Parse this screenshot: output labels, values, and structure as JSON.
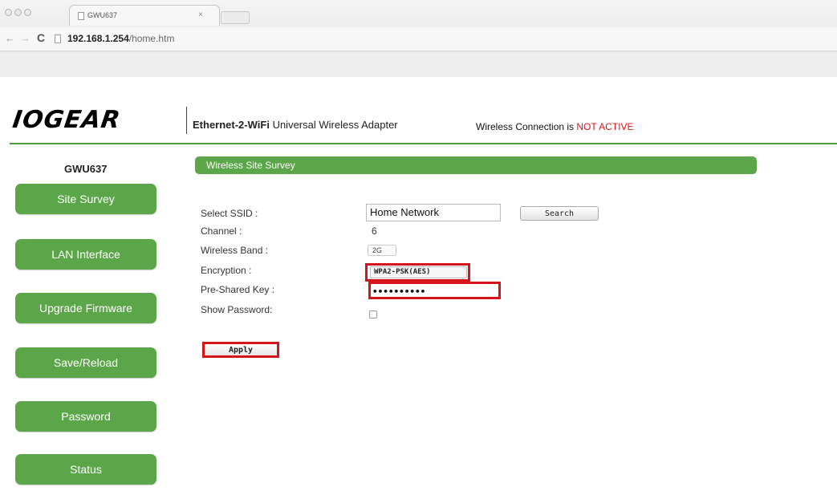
{
  "browser": {
    "tab_title": "GWU637",
    "tab_close": "×",
    "url_host": "192.168.1.254",
    "url_path": "/home.htm",
    "back_glyph": "←",
    "forward_glyph": "→",
    "reload_glyph": "C"
  },
  "header": {
    "logo": "IOGEAR",
    "tagline_bold": "Ethernet-2-WiFi",
    "tagline_rest": " Universal Wireless Adapter",
    "status_prefix": "Wireless Connection is ",
    "status_value": "NOT ACTIVE",
    "status_color": "#e0141a",
    "accent_color": "#5ba648"
  },
  "sidebar": {
    "model": "GWU637",
    "items": [
      {
        "label": "Site Survey"
      },
      {
        "label": "LAN Interface"
      },
      {
        "label": "Upgrade Firmware"
      },
      {
        "label": "Save/Reload"
      },
      {
        "label": "Password"
      },
      {
        "label": "Status"
      }
    ]
  },
  "main": {
    "section_title": "Wireless Site Survey",
    "fields": {
      "ssid_label": "Select SSID :",
      "ssid_value": "Home Network",
      "search_label": "Search",
      "channel_label": "Channel :",
      "channel_value": "6",
      "band_label": "Wireless Band :",
      "band_value": "2G",
      "encryption_label": "Encryption :",
      "encryption_value": "WPA2-PSK(AES)",
      "psk_label": "Pre-Shared Key :",
      "psk_value": "••••••••••",
      "show_password_label": "Show Password:",
      "show_password_checked": false
    },
    "apply_label": "Apply"
  }
}
